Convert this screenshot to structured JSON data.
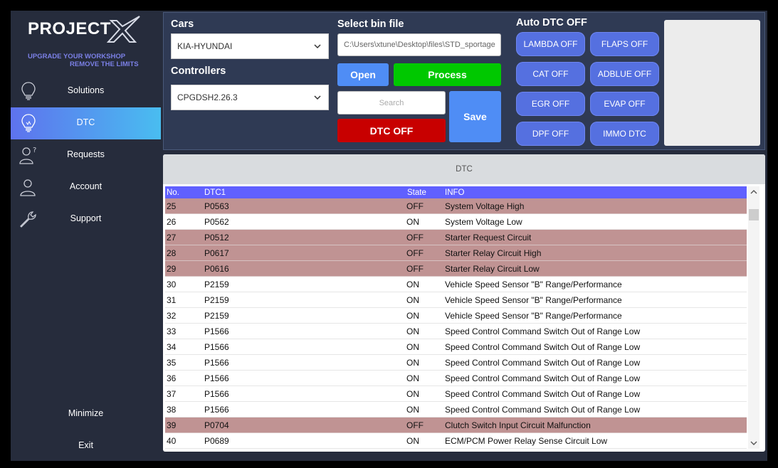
{
  "brand": {
    "logo_text": "PROJECT",
    "tagline_line1": "UPGRADE YOUR WORKSHOP",
    "tagline_line2": "REMOVE THE LIMITS"
  },
  "sidebar": {
    "items": [
      {
        "label": "Solutions",
        "icon": "lightbulb-icon",
        "active": false
      },
      {
        "label": "DTC",
        "icon": "lightbulb-icon",
        "active": true
      },
      {
        "label": "Requests",
        "icon": "user-question-icon",
        "active": false
      },
      {
        "label": "Account",
        "icon": "user-icon",
        "active": false
      },
      {
        "label": "Support",
        "icon": "wrench-icon",
        "active": false
      }
    ],
    "minimize_label": "Minimize",
    "exit_label": "Exit"
  },
  "controls": {
    "cars_label": "Cars",
    "cars_value": "KIA-HYUNDAI",
    "controllers_label": "Controllers",
    "controllers_value": "CPGDSH2.26.3",
    "bin_label": "Select bin file",
    "bin_path": "C:\\Users\\xtune\\Desktop\\files\\STD_sportage",
    "open_label": "Open",
    "process_label": "Process",
    "search_placeholder": "Search",
    "save_label": "Save",
    "dtc_off_label": "DTC OFF"
  },
  "auto_dtc": {
    "title": "Auto DTC OFF",
    "buttons": [
      "LAMBDA OFF",
      "FLAPS OFF",
      "CAT OFF",
      "ADBLUE OFF",
      "EGR OFF",
      "EVAP OFF",
      "DPF OFF",
      "IMMO DTC"
    ]
  },
  "dtc_table": {
    "title": "DTC",
    "columns": [
      "No.",
      "DTC1",
      "State",
      "INFO"
    ],
    "rows": [
      {
        "no": "25",
        "code": "P0563",
        "state": "OFF",
        "info": "System Voltage High"
      },
      {
        "no": "26",
        "code": "P0562",
        "state": "ON",
        "info": "System Voltage Low"
      },
      {
        "no": "27",
        "code": "P0512",
        "state": "OFF",
        "info": "Starter Request Circuit"
      },
      {
        "no": "28",
        "code": "P0617",
        "state": "OFF",
        "info": "Starter Relay Circuit High"
      },
      {
        "no": "29",
        "code": "P0616",
        "state": "OFF",
        "info": "Starter Relay Circuit Low"
      },
      {
        "no": "30",
        "code": "P2159",
        "state": "ON",
        "info": "Vehicle Speed Sensor \"B\" Range/Performance"
      },
      {
        "no": "31",
        "code": "P2159",
        "state": "ON",
        "info": "Vehicle Speed Sensor \"B\" Range/Performance"
      },
      {
        "no": "32",
        "code": "P2159",
        "state": "ON",
        "info": "Vehicle Speed Sensor \"B\" Range/Performance"
      },
      {
        "no": "33",
        "code": "P1566",
        "state": "ON",
        "info": "Speed Control Command Switch Out of Range Low"
      },
      {
        "no": "34",
        "code": "P1566",
        "state": "ON",
        "info": "Speed Control Command Switch Out of Range Low"
      },
      {
        "no": "35",
        "code": "P1566",
        "state": "ON",
        "info": "Speed Control Command Switch Out of Range Low"
      },
      {
        "no": "36",
        "code": "P1566",
        "state": "ON",
        "info": "Speed Control Command Switch Out of Range Low"
      },
      {
        "no": "37",
        "code": "P1566",
        "state": "ON",
        "info": "Speed Control Command Switch Out of Range Low"
      },
      {
        "no": "38",
        "code": "P1566",
        "state": "ON",
        "info": "Speed Control Command Switch Out of Range Low"
      },
      {
        "no": "39",
        "code": "P0704",
        "state": "OFF",
        "info": "Clutch Switch Input Circuit Malfunction"
      },
      {
        "no": "40",
        "code": "P0689",
        "state": "ON",
        "info": "ECM/PCM Power Relay Sense Circuit Low"
      }
    ]
  },
  "colors": {
    "background": "#262c3c",
    "panel": "#2f3a54",
    "active_gradient_start": "#5e72ee",
    "active_gradient_end": "#49bdf0",
    "open_button": "#4f8df5",
    "process_button": "#00c800",
    "dtc_off_button": "#c80000",
    "save_button": "#4f8df5",
    "auto_dtc_button": "#5570e0",
    "table_header": "#6060ff",
    "row_off": "#c09393"
  }
}
